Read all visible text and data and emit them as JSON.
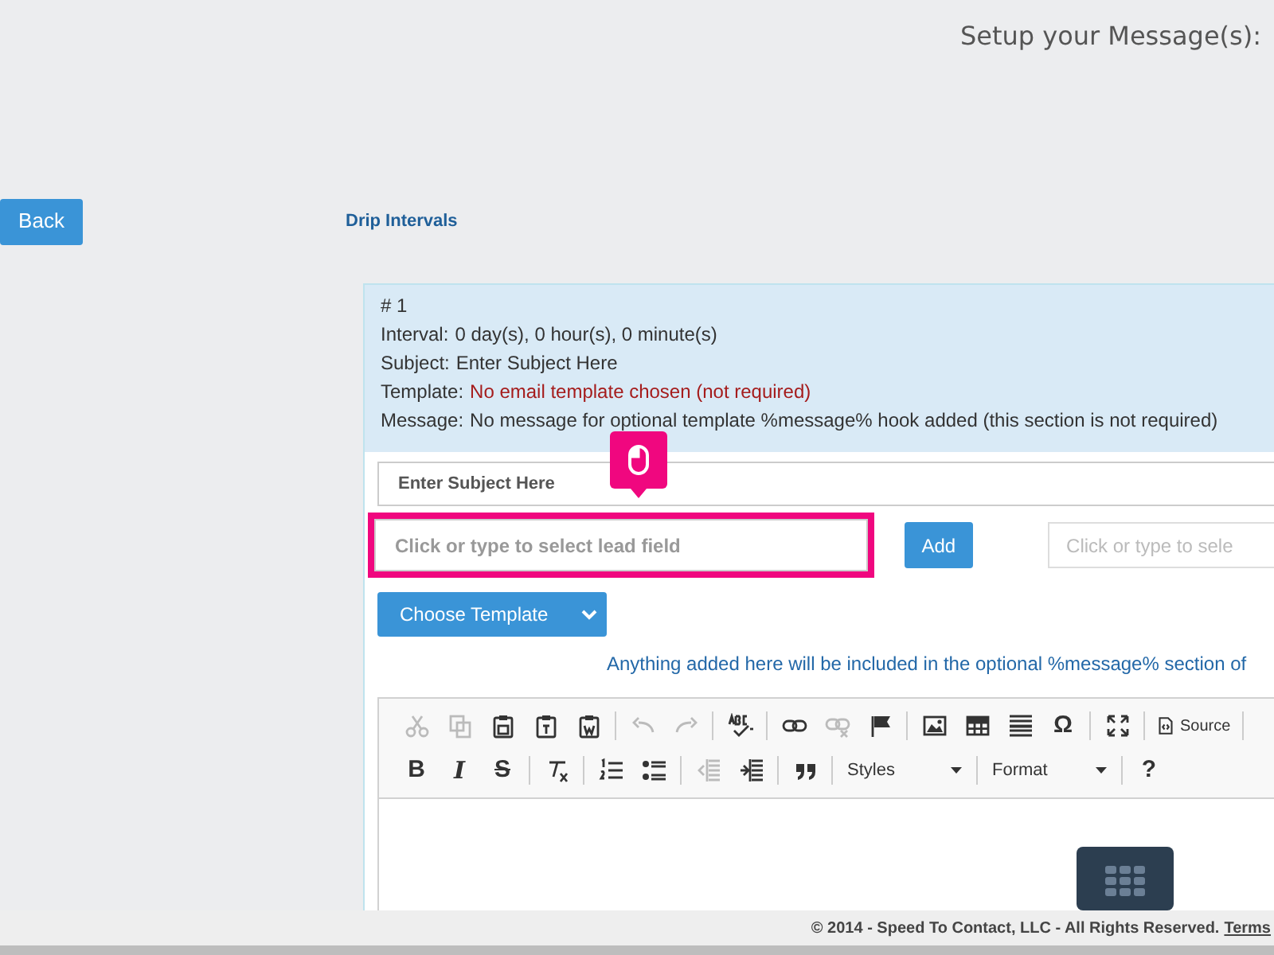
{
  "page_title": "Setup your Message(s):",
  "back_button": "Back",
  "section_heading": "Drip Intervals",
  "summary": {
    "number": "# 1",
    "lines": [
      {
        "label": "Interval:",
        "value": "0 day(s), 0 hour(s), 0 minute(s)",
        "warning": false
      },
      {
        "label": "Subject:",
        "value": "Enter Subject Here",
        "warning": false
      },
      {
        "label": "Template:",
        "value": "No email template chosen (not required)",
        "warning": true
      },
      {
        "label": "Message:",
        "value": "No message for optional template %message% hook added (this section is not required)",
        "warning": false
      }
    ]
  },
  "subject_field": {
    "value": "Enter Subject Here"
  },
  "lead_field": {
    "placeholder": "Click or type to select lead field",
    "highlighted": true
  },
  "add_button": "Add",
  "second_lead_field": {
    "placeholder": "Click or type to sele"
  },
  "template_button": "Choose Template",
  "note": "Anything added here will be included in the optional %message% section of",
  "toolbar_rows": [
    [
      {
        "kind": "icon",
        "disabled": true
      },
      {
        "kind": "icon",
        "disabled": true
      },
      {
        "kind": "icon",
        "disabled": false
      },
      {
        "kind": "icon",
        "disabled": false
      },
      {
        "kind": "icon",
        "disabled": false
      },
      {
        "kind": "separator"
      },
      {
        "kind": "icon",
        "disabled": true
      },
      {
        "kind": "icon",
        "disabled": true
      },
      {
        "kind": "separator"
      },
      {
        "kind": "icon",
        "disabled": false
      },
      {
        "kind": "separator"
      },
      {
        "kind": "icon",
        "disabled": false
      },
      {
        "kind": "icon",
        "disabled": true
      },
      {
        "kind": "icon",
        "disabled": false
      },
      {
        "kind": "separator"
      },
      {
        "kind": "icon",
        "disabled": false
      },
      {
        "kind": "icon",
        "disabled": false
      },
      {
        "kind": "icon",
        "disabled": false
      },
      {
        "kind": "glyph",
        "text": "Ω",
        "disabled": false
      },
      {
        "kind": "separator"
      },
      {
        "kind": "icon",
        "disabled": false
      },
      {
        "kind": "separator"
      },
      {
        "kind": "labeled",
        "label": "Source",
        "disabled": false
      },
      {
        "kind": "separator"
      }
    ],
    [
      {
        "kind": "glyph",
        "text": "B",
        "disabled": false
      },
      {
        "kind": "glyph",
        "text": "I",
        "disabled": false
      },
      {
        "kind": "glyph",
        "text": "S",
        "disabled": false
      },
      {
        "kind": "separator"
      },
      {
        "kind": "icon",
        "disabled": false
      },
      {
        "kind": "separator"
      },
      {
        "kind": "icon",
        "disabled": false
      },
      {
        "kind": "icon",
        "disabled": false
      },
      {
        "kind": "separator"
      },
      {
        "kind": "icon",
        "disabled": true
      },
      {
        "kind": "icon",
        "disabled": false
      },
      {
        "kind": "separator"
      },
      {
        "kind": "icon",
        "disabled": false
      },
      {
        "kind": "separator"
      },
      {
        "kind": "dropdown",
        "label": "Styles"
      },
      {
        "kind": "separator"
      },
      {
        "kind": "dropdown",
        "label": "Format"
      },
      {
        "kind": "separator"
      },
      {
        "kind": "glyph",
        "text": "?",
        "disabled": false
      }
    ]
  ],
  "footer": {
    "copyright": "© 2014 - Speed To Contact, LLC - All Rights Reserved.",
    "link": "Terms"
  }
}
